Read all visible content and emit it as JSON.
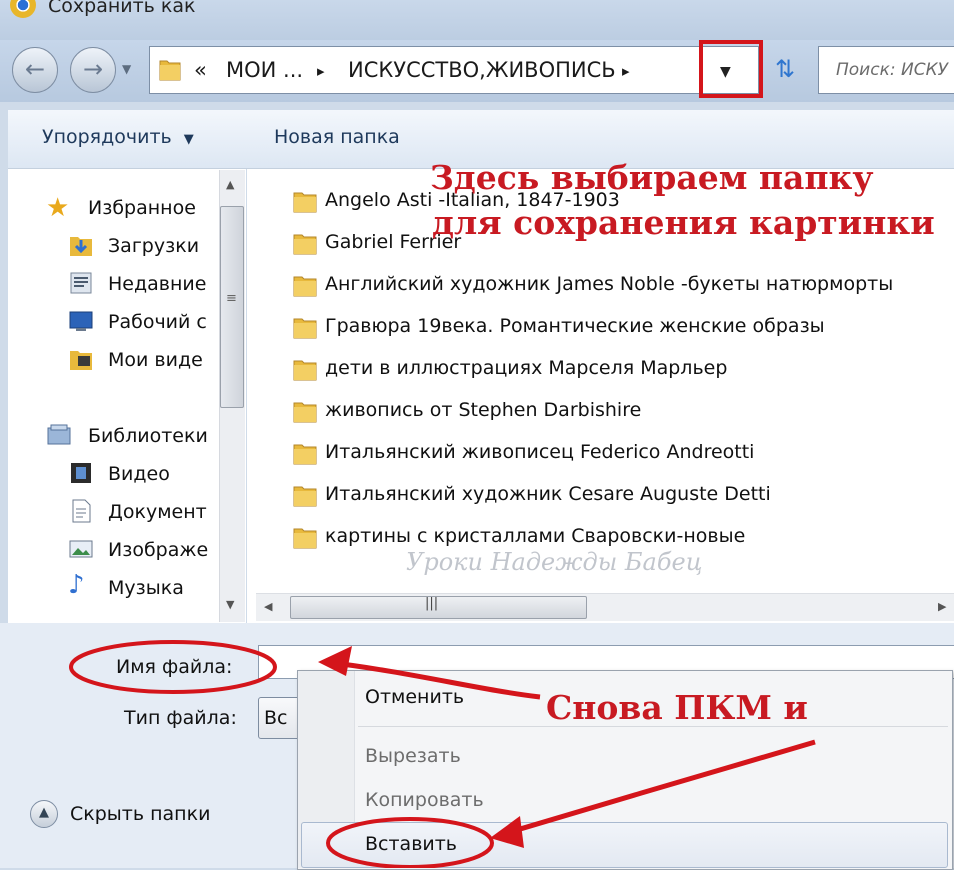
{
  "window": {
    "title": "Сохранить как"
  },
  "nav": {
    "breadcrumb": [
      "«",
      "МОИ ...",
      "▸",
      "ИСКУССТВО,ЖИВОПИСЬ",
      "▸"
    ],
    "search_placeholder": "Поиск: ИСКУ"
  },
  "toolbar": {
    "organize_label": "Упорядочить",
    "new_folder_label": "Новая папка"
  },
  "sidebar": {
    "favorites_header": "Избранное",
    "favorites": [
      "Загрузки",
      "Недавние",
      "Рабочий с",
      "Мои виде"
    ],
    "libraries_header": "Библиотеки",
    "libraries": [
      "Видео",
      "Документ",
      "Изображе",
      "Музыка"
    ]
  },
  "files": [
    "Angelo Asti -Italian, 1847-1903",
    "Gabriel Ferrier",
    "Английский художник James Noble -букеты натюрморты",
    "Гравюра 19века. Романтические женские образы",
    "дети в иллюстрациях Марселя Марльер",
    "живопись от Stephen Darbishire",
    "Итальянский живописец Federico Andreotti",
    "Итальянский художник Cesare Auguste Detti",
    "картины с кристаллами Сваровски-новые"
  ],
  "form": {
    "filename_label": "Имя файла:",
    "filetype_label": "Тип файла:",
    "filetype_value": "Вс",
    "hide_folders_label": "Скрыть папки"
  },
  "context_menu": {
    "undo": "Отменить",
    "cut": "Вырезать",
    "copy": "Копировать",
    "paste": "Вставить"
  },
  "annotations": {
    "line1": "Здесь выбираем папку",
    "line2": "для сохранения картинки",
    "line3": "Снова ПКМ и",
    "watermark": "Уроки Надежды Бабец"
  },
  "colors": {
    "annotation_red": "#c81a22",
    "folder_yellow": "#e8b93c"
  }
}
